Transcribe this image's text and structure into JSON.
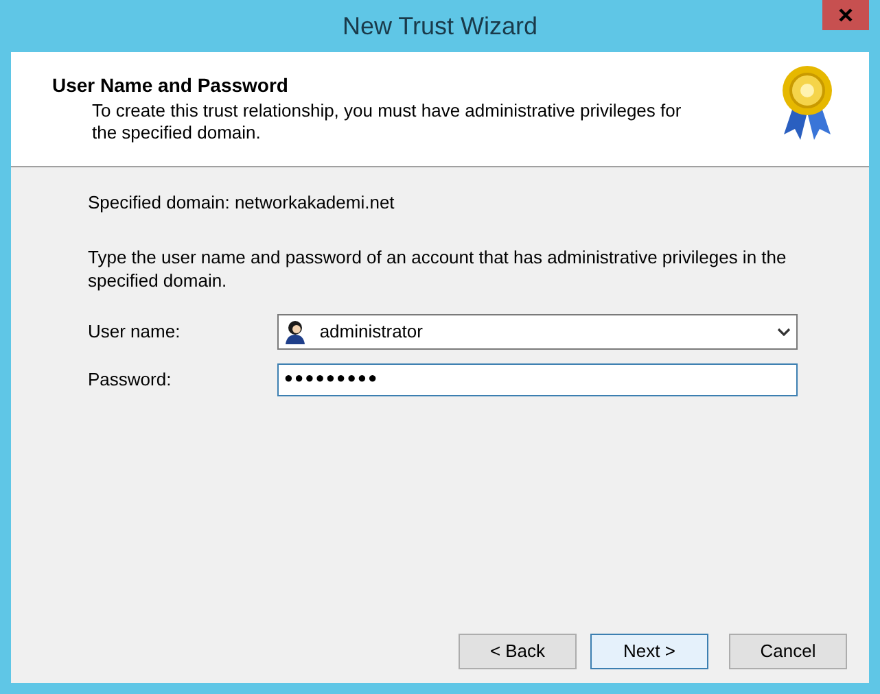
{
  "window": {
    "title": "New Trust Wizard"
  },
  "header": {
    "title": "User Name and Password",
    "description": "To create this trust relationship, you must have administrative privileges for the specified domain."
  },
  "specified_domain": "Specified domain: networkakademi.net",
  "instructions": "Type the user name and password of an account that has administrative privileges in the specified domain.",
  "fields": [
    {
      "kind": "combo",
      "label": "User name:",
      "value": "administrator"
    },
    {
      "kind": "password",
      "label": "Password:",
      "value": "●●●●●●●●●",
      "focused": true
    }
  ],
  "buttons": [
    {
      "label": "< Back",
      "default": false
    },
    {
      "label": "Next >",
      "default": true
    },
    {
      "label": "Cancel",
      "default": false
    }
  ]
}
